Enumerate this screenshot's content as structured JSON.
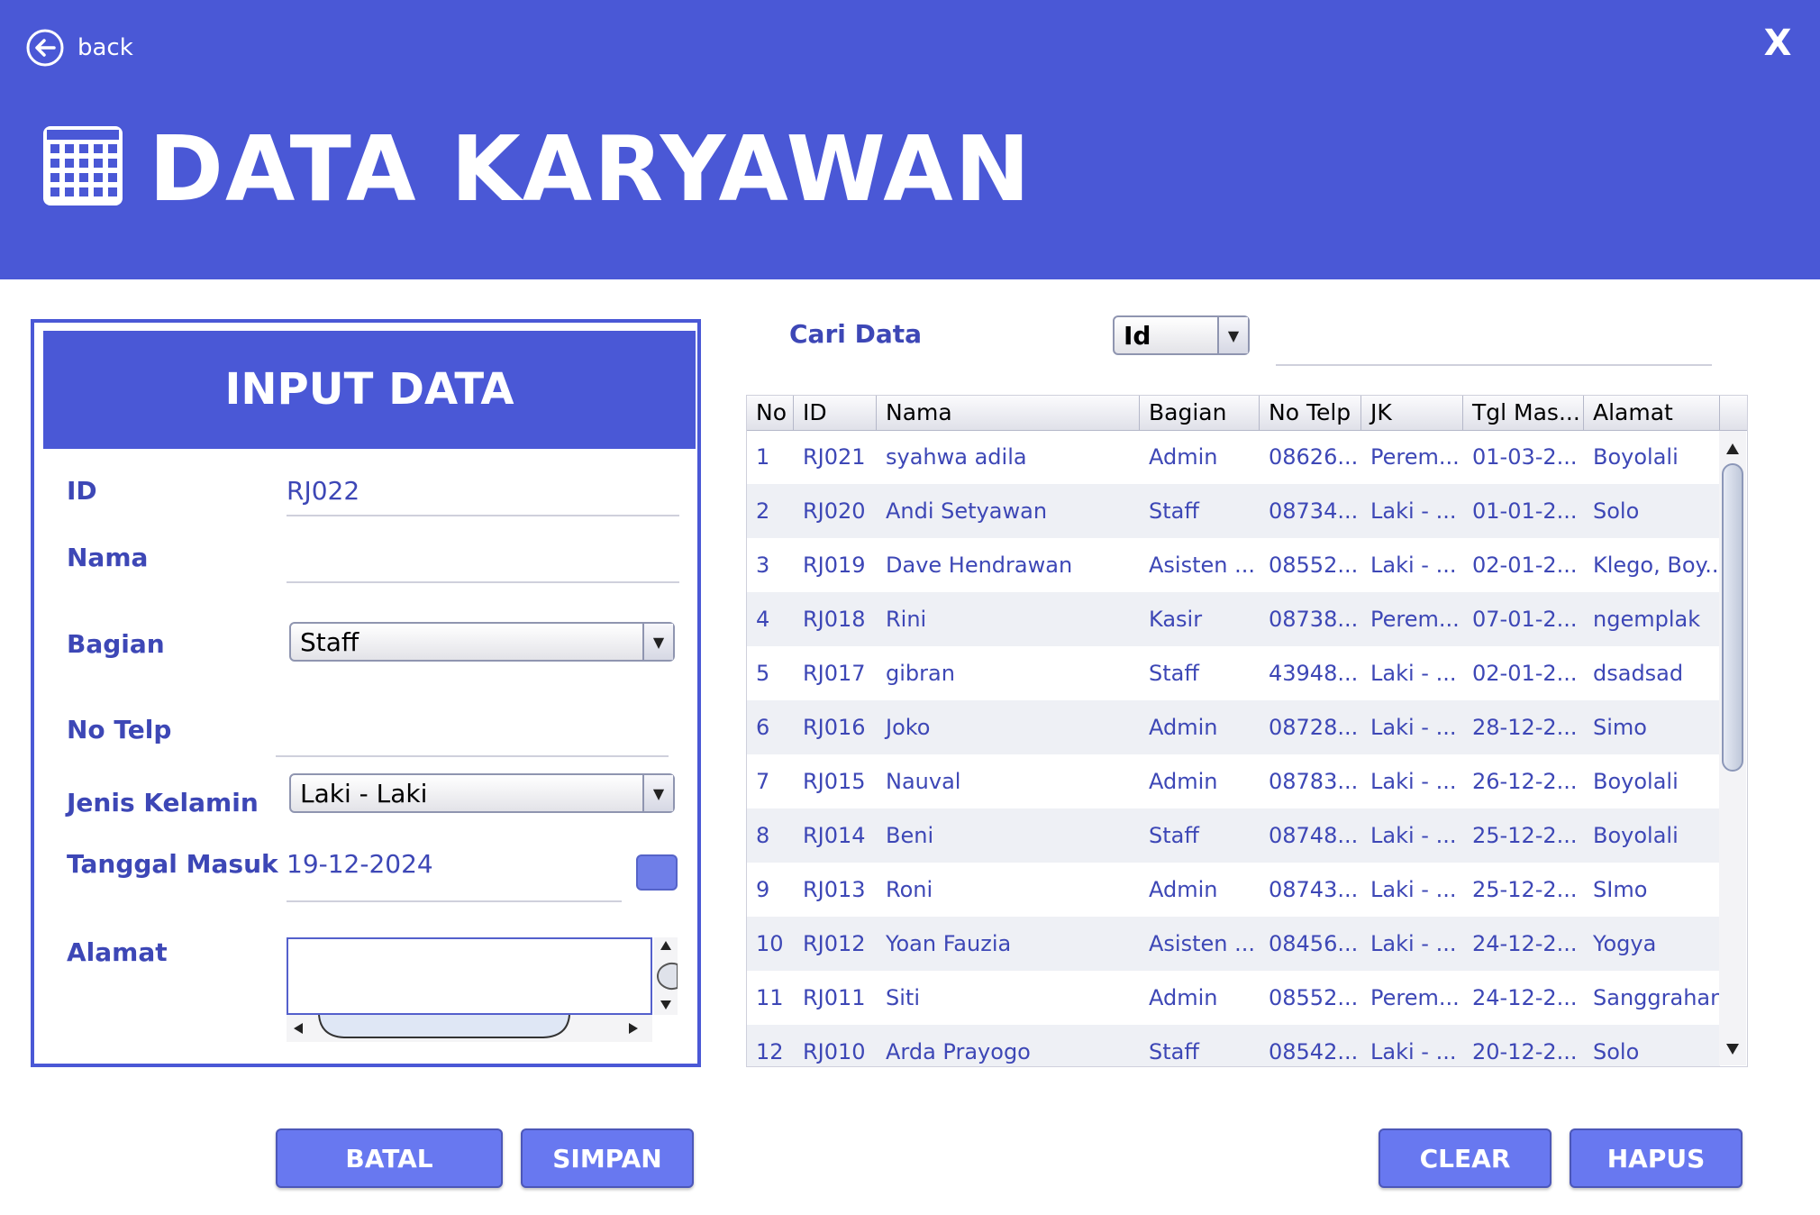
{
  "header": {
    "back_label": "back",
    "close_label": "X",
    "title": "DATA KARYAWAN",
    "title_icon": "calendar-grid-icon",
    "bg_color": "#4a58d6"
  },
  "form": {
    "title": "INPUT DATA",
    "id_label": "ID",
    "id_value": "RJ022",
    "nama_label": "Nama",
    "nama_value": "",
    "bagian_label": "Bagian",
    "bagian_value": "Staff",
    "telp_label": "No Telp",
    "telp_value": "",
    "jk_label": "Jenis Kelamin",
    "jk_value": "Laki - Laki",
    "tgl_label": "Tanggal Masuk",
    "tgl_value": "19-12-2024",
    "alamat_label": "Alamat",
    "alamat_value": ""
  },
  "search": {
    "label": "Cari Data",
    "filter_value": "Id",
    "query": ""
  },
  "table": {
    "columns": [
      "No",
      "ID",
      "Nama",
      "Bagian",
      "No Telp",
      "JK",
      "Tgl Mas...",
      "Alamat"
    ],
    "rows": [
      [
        "1",
        "RJ021",
        "syahwa adila",
        "Admin",
        "08626...",
        "Perem...",
        "01-03-2...",
        "Boyolali"
      ],
      [
        "2",
        "RJ020",
        "Andi Setyawan",
        "Staff",
        "08734...",
        "Laki - ...",
        "01-01-2...",
        "Solo"
      ],
      [
        "3",
        "RJ019",
        "Dave Hendrawan",
        "Asisten ...",
        "08552...",
        "Laki - ...",
        "02-01-2...",
        "Klego, Boy..."
      ],
      [
        "4",
        "RJ018",
        "Rini",
        "Kasir",
        "08738...",
        "Perem...",
        "07-01-2...",
        "ngemplak"
      ],
      [
        "5",
        "RJ017",
        "gibran",
        "Staff",
        "43948...",
        "Laki - ...",
        "02-01-2...",
        "dsadsad"
      ],
      [
        "6",
        "RJ016",
        "Joko",
        "Admin",
        "08728...",
        "Laki - ...",
        "28-12-2...",
        "Simo"
      ],
      [
        "7",
        "RJ015",
        "Nauval",
        "Admin",
        "08783...",
        "Laki - ...",
        "26-12-2...",
        "Boyolali"
      ],
      [
        "8",
        "RJ014",
        "Beni",
        "Staff",
        "08748...",
        "Laki - ...",
        "25-12-2...",
        "Boyolali"
      ],
      [
        "9",
        "RJ013",
        "Roni",
        "Admin",
        "08743...",
        "Laki - ...",
        "25-12-2...",
        "SImo"
      ],
      [
        "10",
        "RJ012",
        "Yoan Fauzia",
        "Asisten ...",
        "08456...",
        "Laki - ...",
        "24-12-2...",
        "Yogya"
      ],
      [
        "11",
        "RJ011",
        "Siti",
        "Admin",
        "08552...",
        "Perem...",
        "24-12-2...",
        "Sanggrahan"
      ],
      [
        "12",
        "RJ010",
        "Arda Prayogo",
        "Staff",
        "08542...",
        "Laki - ...",
        "20-12-2...",
        "Solo"
      ]
    ]
  },
  "buttons": {
    "batal": "BATAL",
    "simpan": "SIMPAN",
    "clear": "CLEAR",
    "hapus": "HAPUS"
  },
  "colors": {
    "accent": "#4a58d6",
    "button": "#6878f0",
    "text": "#3d47b6"
  }
}
